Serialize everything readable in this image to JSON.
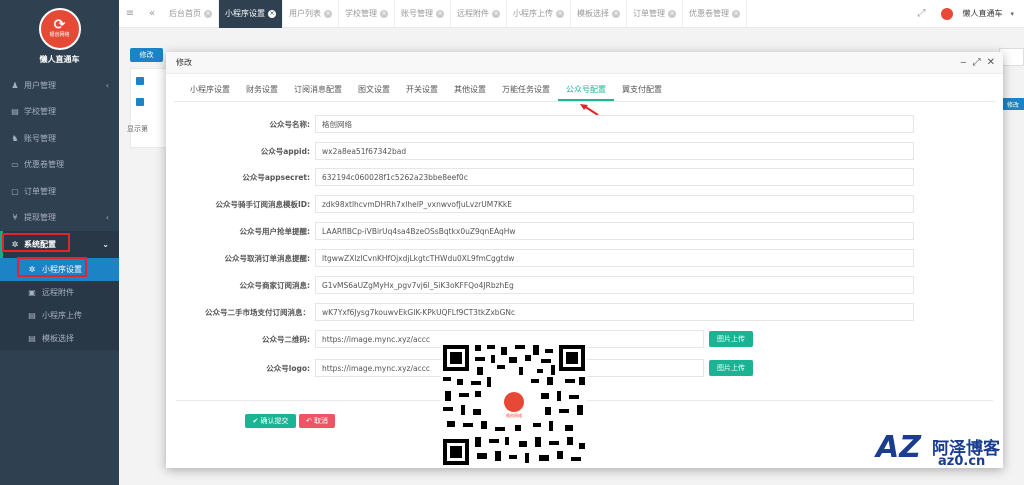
{
  "brand": {
    "logo_mark": "⟳",
    "logo_sub": "银创网络",
    "name": "懒人直通车"
  },
  "sidebar": {
    "items": [
      {
        "label": "用户管理",
        "icon": "user-icon",
        "arrow": "‹"
      },
      {
        "label": "学校管理",
        "icon": "file-icon",
        "arrow": ""
      },
      {
        "label": "账号管理",
        "icon": "users-icon",
        "arrow": ""
      },
      {
        "label": "优惠卷管理",
        "icon": "tag-icon",
        "arrow": ""
      },
      {
        "label": "订单管理",
        "icon": "doc-icon",
        "arrow": ""
      },
      {
        "label": "提现管理",
        "icon": "yen-icon",
        "arrow": "‹"
      },
      {
        "label": "系统配置",
        "icon": "gear-icon",
        "arrow": "⌄"
      }
    ],
    "sub_items": [
      {
        "label": "小程序设置",
        "icon": "gear-icon"
      },
      {
        "label": "远程附件",
        "icon": "image-icon"
      },
      {
        "label": "小程序上传",
        "icon": "file-icon"
      },
      {
        "label": "模板选择",
        "icon": "file-icon"
      }
    ]
  },
  "topbar": {
    "tabs": [
      {
        "label": "后台首页"
      },
      {
        "label": "小程序设置"
      },
      {
        "label": "用户列表"
      },
      {
        "label": "学校管理"
      },
      {
        "label": "账号管理"
      },
      {
        "label": "远程附件"
      },
      {
        "label": "小程序上传"
      },
      {
        "label": "模板选择"
      },
      {
        "label": "订单管理"
      },
      {
        "label": "优惠卷管理"
      }
    ],
    "user_name": "懒人直通车"
  },
  "background": {
    "edit_label": "修改",
    "display_text": "显示第",
    "right_btn": "修改"
  },
  "modal": {
    "title": "修改",
    "tabs": [
      "小程序设置",
      "财务设置",
      "订阅消息配置",
      "图文设置",
      "开关设置",
      "其他设置",
      "万能任务设置",
      "公众号配置",
      "翼支付配置"
    ],
    "fields": [
      {
        "label": "公众号名称:",
        "value": "格创网络"
      },
      {
        "label": "公众号appid:",
        "value": "wx2a8ea51f67342bad"
      },
      {
        "label": "公众号appsecret:",
        "value": "632194c060028f1c5262a23bbe8eef0c"
      },
      {
        "label": "公众号骑手订阅消息模板ID:",
        "value": "zdk98xtlhcvmDHRh7xlheIP_vxnwvofJuLvzrUM7KkE"
      },
      {
        "label": "公众号用户抢单提醒:",
        "value": "LAARfIBCp-iVBirUq4sa4BzeOSsBqtkx0uZ9qnEAqHw"
      },
      {
        "label": "公众号取消订单消息提醒:",
        "value": "ltgwwZXlzICvnKHfOjxdjLkgtcTHWdu0XL9fmCggtdw"
      },
      {
        "label": "公众号商家订阅消息:",
        "value": "G1vMS6aUZgMyHx_pgv7vj6l_SiK3oKFFQo4JRbzhEg"
      },
      {
        "label": "公众号二手市场支付订阅消息：",
        "value": "wK7Yxf6Jysg7kouwvEkGIK-KPkUQFLf9CT3tkZxbGNc"
      }
    ],
    "upload_fields": [
      {
        "label": "公众号二维码:",
        "value": "https://image.mync.xyz/accc",
        "button": "图片上传"
      },
      {
        "label": "公众号logo:",
        "value": "https://image.mync.xyz/accc",
        "button": "图片上传"
      }
    ],
    "submit_label": "✔ 确认提交",
    "cancel_label": "↶ 取消"
  },
  "qr": {
    "center_text": "格创网络"
  },
  "watermark": {
    "az": "AZ",
    "cn": "阿泽博客",
    "url": "az0.cn"
  },
  "colors": {
    "sidebar": "#2f4050",
    "accent_green": "#1ab394",
    "accent_blue": "#1c84c6",
    "highlight_red": "#e0262b"
  }
}
